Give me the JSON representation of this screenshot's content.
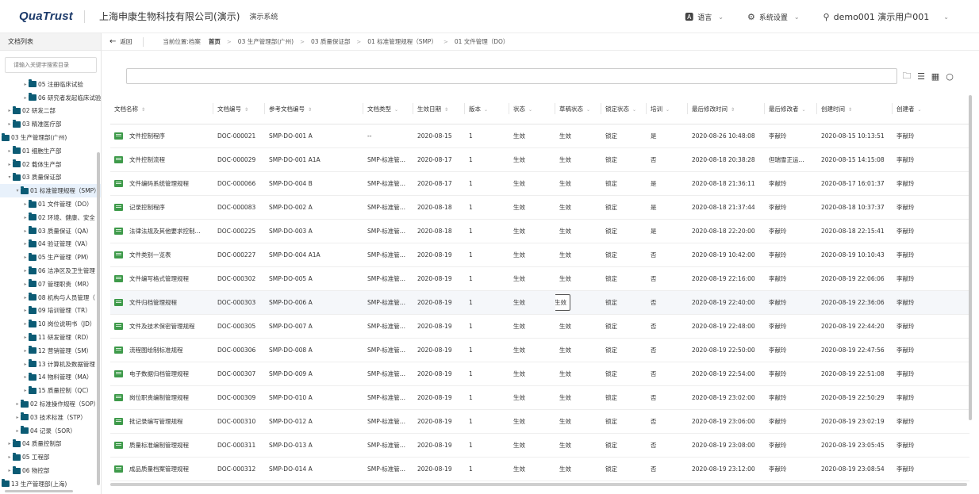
{
  "header": {
    "logo": "QuaTrust",
    "company": "上海申康生物科技有限公司(演示)",
    "system": "演示系统",
    "language": "语言",
    "settings": "系统设置",
    "user": "demo001 演示用户001"
  },
  "sidebar": {
    "title": "文档列表",
    "search_placeholder": "请输入关键字搜索目录",
    "items": [
      {
        "label": "05 注册临床试验",
        "indent": 2,
        "toggle": "▸"
      },
      {
        "label": "06 研究者发起临床试验",
        "indent": 2,
        "toggle": "▸"
      },
      {
        "label": "02 研发二部",
        "indent": 0,
        "toggle": "▸"
      },
      {
        "label": "03 精准医疗部",
        "indent": 0,
        "toggle": "▸"
      },
      {
        "label": "03 生产管理部(广州)",
        "indent": -1,
        "toggle": ""
      },
      {
        "label": "01 细胞生产部",
        "indent": 0,
        "toggle": "▸"
      },
      {
        "label": "02 载体生产部",
        "indent": 0,
        "toggle": "▸"
      },
      {
        "label": "03 质量保证部",
        "indent": 0,
        "toggle": "▾"
      },
      {
        "label": "01 标准管理规程（SMP）",
        "indent": 1,
        "toggle": "▾",
        "active": true
      },
      {
        "label": "01 文件管理（DO）",
        "indent": 2,
        "toggle": "▸"
      },
      {
        "label": "02 环境、健康、安全",
        "indent": 2,
        "toggle": "▸"
      },
      {
        "label": "03 质量保证（QA）",
        "indent": 2,
        "toggle": "▸"
      },
      {
        "label": "04 验证管理（VA）",
        "indent": 2,
        "toggle": "▸"
      },
      {
        "label": "05 生产管理（PM）",
        "indent": 2,
        "toggle": "▸"
      },
      {
        "label": "06 洁净区及卫生管理",
        "indent": 2,
        "toggle": "▸"
      },
      {
        "label": "07 管理职责（MR）",
        "indent": 2,
        "toggle": "▸"
      },
      {
        "label": "08 机构与人员管理（",
        "indent": 2,
        "toggle": "▸"
      },
      {
        "label": "09 培训管理（TR）",
        "indent": 2,
        "toggle": "▸"
      },
      {
        "label": "10 岗位说明书（JD）",
        "indent": 2,
        "toggle": "▸"
      },
      {
        "label": "11 研发管理（RD）",
        "indent": 2,
        "toggle": "▸"
      },
      {
        "label": "12 营销管理（SM）",
        "indent": 2,
        "toggle": "▸"
      },
      {
        "label": "13 计算机及数据管理",
        "indent": 2,
        "toggle": "▸"
      },
      {
        "label": "14 物料管理（MA）",
        "indent": 2,
        "toggle": "▸"
      },
      {
        "label": "15 质量控制（QC）",
        "indent": 2,
        "toggle": "▸"
      },
      {
        "label": "02 标准操作规程（SOP）",
        "indent": 1,
        "toggle": "▸"
      },
      {
        "label": "03 技术标准（STP）",
        "indent": 1,
        "toggle": "▸"
      },
      {
        "label": "04 记录（SOR）",
        "indent": 1,
        "toggle": "▸"
      },
      {
        "label": "04 质量控制部",
        "indent": 0,
        "toggle": "▸"
      },
      {
        "label": "05 工程部",
        "indent": 0,
        "toggle": "▸"
      },
      {
        "label": "06 物控部",
        "indent": 0,
        "toggle": "▸"
      },
      {
        "label": "13 生产管理部(上海)",
        "indent": -1,
        "toggle": ""
      }
    ]
  },
  "breadcrumb": {
    "back": "返回",
    "label": "当前位置:档案",
    "items": [
      "首页",
      "03 生产管理部(广州)",
      "03 质量保证部",
      "01 标准管理规程（SMP）",
      "01 文件管理（DO）"
    ]
  },
  "table": {
    "columns": [
      "文档名称",
      "文档编号",
      "参考文档编号",
      "文档类型",
      "生效日期",
      "版本",
      "状态",
      "草稿状态",
      "锁定状态",
      "培训",
      "最后修改时间",
      "最后修改者",
      "创建时间",
      "创建者"
    ],
    "rows": [
      [
        "文件控制程序",
        "DOC-000021",
        "SMP-DO-001 A",
        "--",
        "2020-08-15",
        "1",
        "生效",
        "生效",
        "锁定",
        "是",
        "2020-08-26 10:48:08",
        "李献玲",
        "2020-08-15 10:13:51",
        "李献玲"
      ],
      [
        "文件控制流程",
        "DOC-000029",
        "SMP-DO-001 A1A",
        "SMP-标准管...",
        "2020-08-17",
        "1",
        "生效",
        "生效",
        "锁定",
        "否",
        "2020-08-18 20:38:28",
        "但瑞雪正运...",
        "2020-08-15 14:15:08",
        "李献玲"
      ],
      [
        "文件编码系统管理规程",
        "DOC-000066",
        "SMP-DO-004 B",
        "SMP-标准管...",
        "2020-08-17",
        "1",
        "生效",
        "生效",
        "锁定",
        "是",
        "2020-08-18 21:36:11",
        "李献玲",
        "2020-08-17 16:01:37",
        "李献玲"
      ],
      [
        "记录控制程序",
        "DOC-000083",
        "SMP-DO-002 A",
        "SMP-标准管...",
        "2020-08-18",
        "1",
        "生效",
        "生效",
        "锁定",
        "是",
        "2020-08-18 21:37:44",
        "李献玲",
        "2020-08-18 10:37:37",
        "李献玲"
      ],
      [
        "法律法规及其他要求控制...",
        "DOC-000225",
        "SMP-DO-003 A",
        "SMP-标准管...",
        "2020-08-18",
        "1",
        "生效",
        "生效",
        "锁定",
        "是",
        "2020-08-18 22:20:00",
        "李献玲",
        "2020-08-18 22:15:41",
        "李献玲"
      ],
      [
        "文件类别一览表",
        "DOC-000227",
        "SMP-DO-004 A1A",
        "SMP-标准管...",
        "2020-08-19",
        "1",
        "生效",
        "生效",
        "锁定",
        "否",
        "2020-08-19 10:42:00",
        "李献玲",
        "2020-08-19 10:10:43",
        "李献玲"
      ],
      [
        "文件编写格式管理规程",
        "DOC-000302",
        "SMP-DO-005 A",
        "SMP-标准管...",
        "2020-08-19",
        "1",
        "生效",
        "生效",
        "锁定",
        "否",
        "2020-08-19 22:16:00",
        "李献玲",
        "2020-08-19 22:06:06",
        "李献玲"
      ],
      [
        "文件归档管理规程",
        "DOC-000303",
        "SMP-DO-006 A",
        "SMP-标准管...",
        "2020-08-19",
        "1",
        "生效",
        "生效",
        "锁定",
        "否",
        "2020-08-19 22:40:00",
        "李献玲",
        "2020-08-19 22:36:06",
        "李献玲"
      ],
      [
        "文件及技术保密管理规程",
        "DOC-000305",
        "SMP-DO-007 A",
        "SMP-标准管...",
        "2020-08-19",
        "1",
        "生效",
        "生效",
        "锁定",
        "否",
        "2020-08-19 22:48:00",
        "李献玲",
        "2020-08-19 22:44:20",
        "李献玲"
      ],
      [
        "流程图绘制标准规程",
        "DOC-000306",
        "SMP-DO-008 A",
        "SMP-标准管...",
        "2020-08-19",
        "1",
        "生效",
        "生效",
        "锁定",
        "否",
        "2020-08-19 22:50:00",
        "李献玲",
        "2020-08-19 22:47:56",
        "李献玲"
      ],
      [
        "电子数据归档管理规程",
        "DOC-000307",
        "SMP-DO-009 A",
        "SMP-标准管...",
        "2020-08-19",
        "1",
        "生效",
        "生效",
        "锁定",
        "否",
        "2020-08-19 22:54:00",
        "李献玲",
        "2020-08-19 22:51:08",
        "李献玲"
      ],
      [
        "岗位职责编制管理规程",
        "DOC-000309",
        "SMP-DO-010 A",
        "SMP-标准管...",
        "2020-08-19",
        "1",
        "生效",
        "生效",
        "锁定",
        "否",
        "2020-08-19 23:02:00",
        "李献玲",
        "2020-08-19 22:50:29",
        "李献玲"
      ],
      [
        "批记录编写管理规程",
        "DOC-000310",
        "SMP-DO-012 A",
        "SMP-标准管...",
        "2020-08-19",
        "1",
        "生效",
        "生效",
        "锁定",
        "否",
        "2020-08-19 23:06:00",
        "李献玲",
        "2020-08-19 23:02:19",
        "李献玲"
      ],
      [
        "质量标准编制管理规程",
        "DOC-000311",
        "SMP-DO-013 A",
        "SMP-标准管...",
        "2020-08-19",
        "1",
        "生效",
        "生效",
        "锁定",
        "否",
        "2020-08-19 23:08:00",
        "李献玲",
        "2020-08-19 23:05:45",
        "李献玲"
      ],
      [
        "成品质量档案管理规程",
        "DOC-000312",
        "SMP-DO-014 A",
        "SMP-标准管...",
        "2020-08-19",
        "1",
        "生效",
        "生效",
        "锁定",
        "否",
        "2020-08-19 23:12:00",
        "李献玲",
        "2020-08-19 23:08:54",
        "李献玲"
      ]
    ],
    "tooltip": "生效"
  }
}
